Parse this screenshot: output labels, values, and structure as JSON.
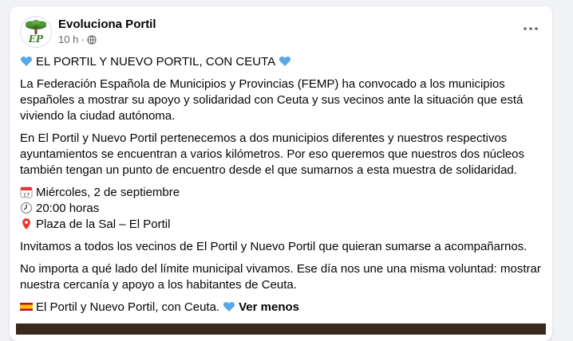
{
  "post": {
    "author": "Evoluciona Portil",
    "avatar_text": "EP",
    "time": "10 h",
    "time_separator": "·",
    "audience_icon": "globe-icon",
    "more_icon": "more-options-icon"
  },
  "content": {
    "title": "EL PORTIL Y NUEVO PORTIL, CON CEUTA",
    "paragraph1": [
      "La Federación Española de Municipios y Provincias (FEMP) ha convocado a los municipios",
      "españoles a mostrar su apoyo y solidaridad con Ceuta y sus vecinos ante la situación que está",
      "viviendo la ciudad autónoma."
    ],
    "paragraph2": [
      "En El Portil y Nuevo Portil pertenecemos a dos municipios diferentes y nuestros respectivos",
      "ayuntamientos se encuentran a varios kilómetros. Por eso queremos que nuestros dos núcleos",
      "también tengan un punto de encuentro desde el que sumarnos a esta muestra de solidaridad."
    ],
    "event": {
      "date": "Miércoles, 2 de septiembre",
      "time": "20:00 horas",
      "place": "Plaza de la Sal – El Portil"
    },
    "paragraph3": "Invitamos a todos los vecinos de El Portil y Nuevo Portil que quieran sumarse a acompañarnos.",
    "paragraph4": [
      "No importa a qué lado del límite municipal vivamos. Ese día nos une una misma voluntad: mostrar",
      "nuestra cercanía y apoyo a los habitantes de Ceuta."
    ],
    "closing": "El Portil y Nuevo Portil, con Ceuta.",
    "see_less": "Ver menos"
  },
  "colors": {
    "heart": "#5aa9e6",
    "text": "#050505",
    "secondary": "#65676b",
    "background": "#f0f2f5",
    "card": "#ffffff"
  }
}
